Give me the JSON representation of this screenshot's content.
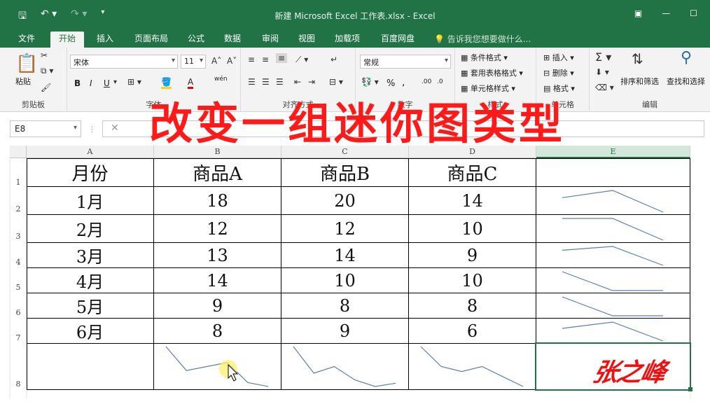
{
  "window": {
    "title": "新建 Microsoft Excel 工作表.xlsx - Excel"
  },
  "tabs": [
    {
      "label": "文件"
    },
    {
      "label": "开始"
    },
    {
      "label": "插入"
    },
    {
      "label": "页面布局"
    },
    {
      "label": "公式"
    },
    {
      "label": "数据"
    },
    {
      "label": "审阅"
    },
    {
      "label": "视图"
    },
    {
      "label": "加载项"
    },
    {
      "label": "百度网盘"
    }
  ],
  "tellme": "告诉我您想要做什么...",
  "ribbon": {
    "paste": "粘贴",
    "clipboard": "剪贴板",
    "font_name": "宋体",
    "font_size": "11",
    "font_group": "字体",
    "align_group": "对齐方式",
    "number_format": "常规",
    "number_group": "数字",
    "cond_format": "条件格式",
    "table_format": "套用表格格式",
    "cell_style": "单元格样式",
    "style_group": "样式",
    "insert": "插入",
    "delete": "删除",
    "format": "格式",
    "cells_group": "单元格",
    "sort_filter": "排序和筛选",
    "find_select": "查找和选择",
    "edit_group": "编辑",
    "bold": "B",
    "italic": "I",
    "underline": "U",
    "wen": "wén",
    "percent": "%",
    "comma": ",",
    "dec_inc": ".00",
    "dec_dec": ".0"
  },
  "namebox": "E8",
  "headline": "改变一组迷你图类型",
  "columns": [
    "A",
    "B",
    "C",
    "D",
    "E"
  ],
  "rows": [
    "1",
    "2",
    "3",
    "4",
    "5",
    "6",
    "7",
    "8"
  ],
  "table": {
    "header": [
      "月份",
      "商品A",
      "商品B",
      "商品C"
    ],
    "body": [
      [
        "1月",
        "18",
        "20",
        "14"
      ],
      [
        "2月",
        "12",
        "12",
        "10"
      ],
      [
        "3月",
        "13",
        "14",
        "9"
      ],
      [
        "4月",
        "14",
        "10",
        "10"
      ],
      [
        "5月",
        "9",
        "8",
        "8"
      ],
      [
        "6月",
        "8",
        "9",
        "6"
      ]
    ]
  },
  "sparkline_color": "#5b7fb3",
  "signature": "张之峰"
}
